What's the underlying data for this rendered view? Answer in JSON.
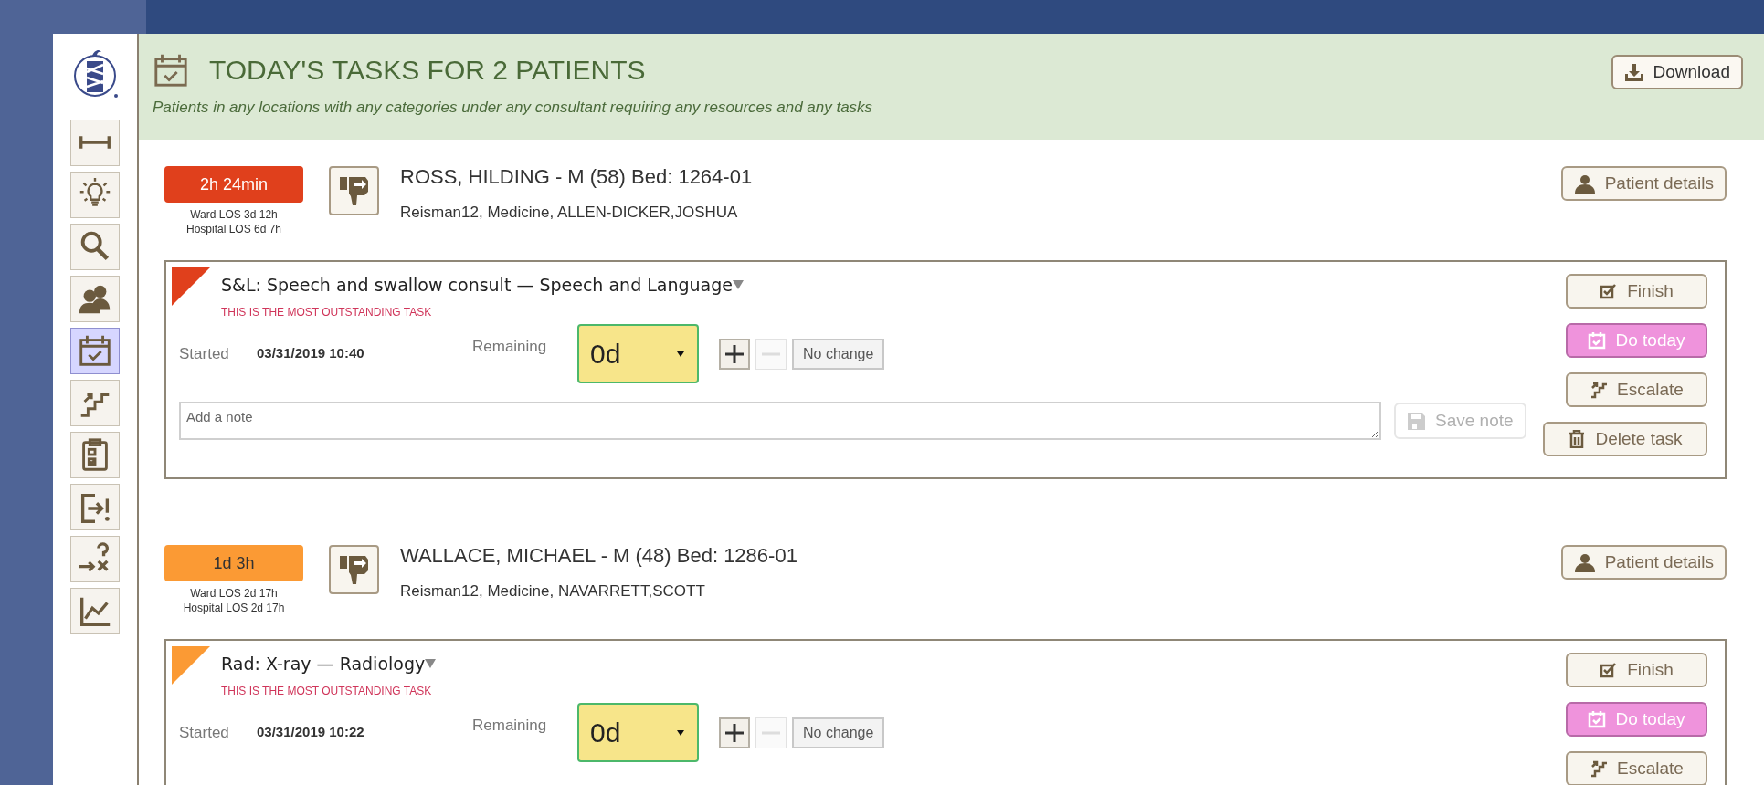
{
  "sidebar": {
    "items": [
      {
        "kind": "ruler",
        "selected": false
      },
      {
        "kind": "bulb",
        "selected": false
      },
      {
        "kind": "search",
        "selected": false
      },
      {
        "kind": "people",
        "selected": false
      },
      {
        "kind": "calendar",
        "selected": true
      },
      {
        "kind": "stairs",
        "selected": false
      },
      {
        "kind": "clipboard",
        "selected": false
      },
      {
        "kind": "exit-alert",
        "selected": false
      },
      {
        "kind": "arrow-question",
        "selected": false
      },
      {
        "kind": "chart",
        "selected": false
      }
    ]
  },
  "header": {
    "title": "TODAY'S TASKS FOR 2 PATIENTS",
    "subtitle": "Patients in any locations with any categories under any consultant requiring any resources and any tasks",
    "download_button": "Download"
  },
  "patients": [
    {
      "los_badge": {
        "text": "2h 24min",
        "color": "#e0401c"
      },
      "ward_los": "Ward LOS 3d 12h",
      "hospital_los": "Hospital LOS 6d 7h",
      "name": "ROSS, HILDING - M (58) Bed: 1264-01",
      "details": "Reisman12, Medicine, ALLEN-DICKER,JOSHUA",
      "details_button": "Patient details",
      "task": {
        "color": "#e0401c",
        "title": "S&L: Speech and swallow consult — Speech and Language",
        "notice": "THIS IS THE MOST OUTSTANDING TASK",
        "started_label": "Started",
        "started": "03/31/2019 10:40",
        "remaining_label": "Remaining",
        "remaining": "0d",
        "no_change": "No change",
        "note_placeholder": "Add a note",
        "save_note": {
          "label": "Save note",
          "disabled": true
        },
        "buttons": [
          {
            "kind": "finish",
            "label": "Finish"
          },
          {
            "kind": "today",
            "label": "Do today"
          },
          {
            "kind": "escalate",
            "label": "Escalate"
          },
          {
            "kind": "delete",
            "label": "Delete task"
          }
        ]
      }
    },
    {
      "los_badge": {
        "text": "1d 3h",
        "color": "#fb9a34"
      },
      "ward_los": "Ward LOS 2d 17h",
      "hospital_los": "Hospital LOS 2d 17h",
      "name": "WALLACE, MICHAEL - M (48) Bed: 1286-01",
      "details": "Reisman12, Medicine, NAVARRETT,SCOTT",
      "details_button": "Patient details",
      "task": {
        "color": "#fb9a34",
        "title": "Rad: X-ray — Radiology",
        "notice": "THIS IS THE MOST OUTSTANDING TASK",
        "started_label": "Started",
        "started": "03/31/2019 10:22",
        "remaining_label": "Remaining",
        "remaining": "0d",
        "no_change": "No change",
        "buttons": [
          {
            "kind": "finish",
            "label": "Finish"
          },
          {
            "kind": "today",
            "label": "Do today"
          },
          {
            "kind": "escalate",
            "label": "Escalate"
          }
        ]
      }
    }
  ]
}
